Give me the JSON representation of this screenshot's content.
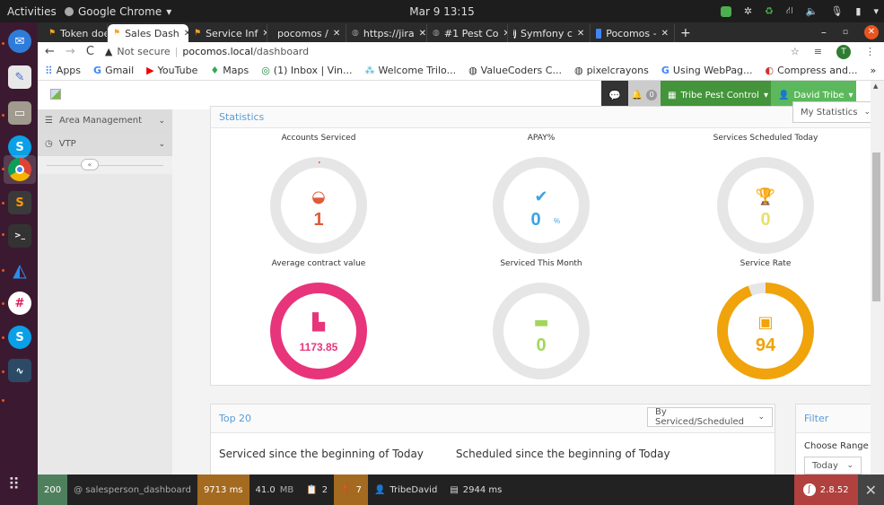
{
  "os": {
    "activities": "Activities",
    "app_name": "Google Chrome",
    "clock": "Mar 9  13:15",
    "dock_apps": [
      "thunderbird",
      "text-editor",
      "files",
      "skype",
      "chrome",
      "sublime-text",
      "terminal",
      "app-launcher",
      "slack",
      "skype",
      "mysql-workbench"
    ]
  },
  "browser": {
    "tabs": [
      {
        "label": "Token doe",
        "active": false
      },
      {
        "label": "Sales Dash",
        "active": true
      },
      {
        "label": "Service Inf",
        "active": false
      },
      {
        "label": "pocomos /",
        "active": false
      },
      {
        "label": "https://jira",
        "active": false
      },
      {
        "label": "#1 Pest Co",
        "active": false
      },
      {
        "label": "Symfony c",
        "active": false
      },
      {
        "label": "Pocomos -",
        "active": false
      }
    ],
    "new_tab": "+",
    "security": "Not secure",
    "url_host": "pocomos.local",
    "url_path": "/dashboard",
    "profile_initial": "T",
    "bookmarks": [
      {
        "label": "Apps"
      },
      {
        "label": "Gmail"
      },
      {
        "label": "YouTube"
      },
      {
        "label": "Maps"
      },
      {
        "label": "(1) Inbox | Vin..."
      },
      {
        "label": "Welcome Trilo..."
      },
      {
        "label": "ValueCoders C..."
      },
      {
        "label": "pixelcrayons"
      },
      {
        "label": "Using WebPag..."
      },
      {
        "label": "Compress and..."
      }
    ],
    "bookmarks_more": "»"
  },
  "header": {
    "notification_count": "0",
    "company": "Tribe Pest Control",
    "user": "David Tribe"
  },
  "sidebar": {
    "items": [
      {
        "label": "Area Management"
      },
      {
        "label": "VTP"
      }
    ],
    "collapse": "«"
  },
  "statistics": {
    "title": "Statistics",
    "select": "My Statistics",
    "cards": [
      {
        "label": "Accounts Serviced",
        "value": "1",
        "suffix": "",
        "icon": "dashboard-gauge-icon",
        "color": "#e05a3a",
        "progress": 0.005
      },
      {
        "label": "APAY%",
        "value": "0",
        "suffix": "%",
        "icon": "check-icon",
        "color": "#3aa3e3",
        "progress": 0
      },
      {
        "label": "Services Scheduled Today",
        "value": "0",
        "suffix": "",
        "icon": "trophy-icon",
        "color": "#e8df6a",
        "progress": 0
      },
      {
        "label": "Average contract value",
        "value": "1173.85",
        "suffix": "",
        "icon": "bar-chart-icon",
        "color": "#e8347a",
        "progress": 1
      },
      {
        "label": "Serviced This Month",
        "value": "0",
        "suffix": "",
        "icon": "calendar-icon",
        "color": "#a3d65c",
        "progress": 0
      },
      {
        "label": "Service Rate",
        "value": "94",
        "suffix": "",
        "icon": "money-icon",
        "color": "#f0a30a",
        "progress": 0.94
      }
    ]
  },
  "top20": {
    "title": "Top 20",
    "select": "By Serviced/Scheduled",
    "col1": "Serviced since the beginning of Today",
    "col2": "Scheduled since the beginning of Today"
  },
  "filter": {
    "title": "Filter",
    "range_label": "Choose Range",
    "range_value": "Today"
  },
  "debug": {
    "status": "200",
    "route": "@ salesperson_dashboard",
    "time": "9713 ms",
    "memory": "41.0",
    "memory_unit": "MB",
    "forms": "2",
    "warnings": "7",
    "user": "TribeDavid",
    "db_time": "2944 ms",
    "version": "2.8.52"
  }
}
